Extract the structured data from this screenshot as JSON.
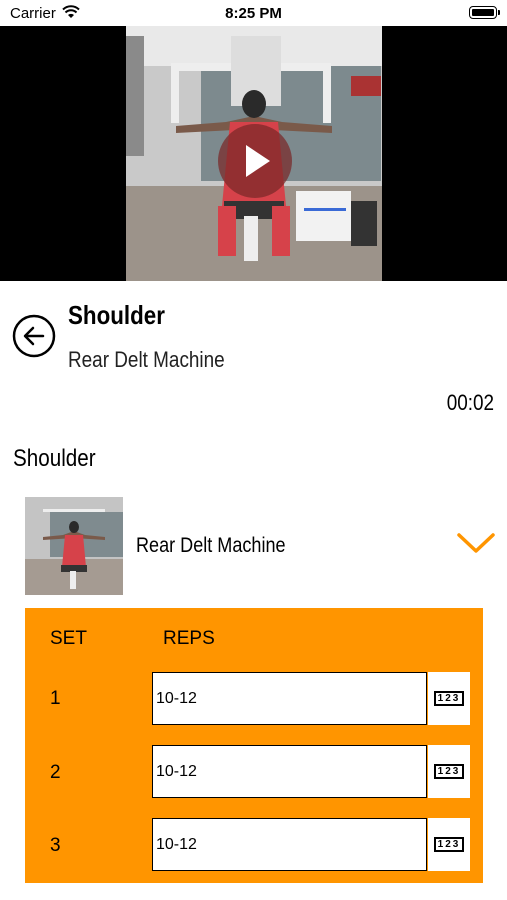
{
  "status_bar": {
    "carrier": "Carrier",
    "time": "8:25 PM"
  },
  "video": {
    "state": "paused",
    "play_icon": "play-icon"
  },
  "header": {
    "title": "Shoulder",
    "subtitle": "Rear Delt Machine",
    "timer": "00:02",
    "back_icon": "back-arrow-icon"
  },
  "section": {
    "title": "Shoulder"
  },
  "exercise": {
    "name": "Rear Delt Machine",
    "expand_icon": "chevron-down-icon"
  },
  "sets_table": {
    "header_set": "SET",
    "header_reps": "REPS",
    "rows": [
      {
        "set": "1",
        "reps": "10-12"
      },
      {
        "set": "2",
        "reps": "10-12"
      },
      {
        "set": "3",
        "reps": "10-12"
      }
    ],
    "keyboard_icon_label": "123"
  },
  "colors": {
    "accent": "#ff9500",
    "play_button": "#7a2828"
  }
}
